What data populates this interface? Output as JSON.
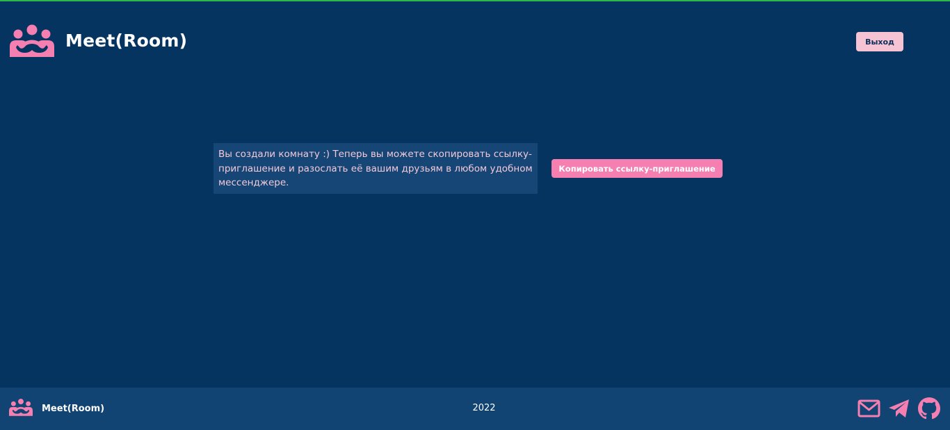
{
  "header": {
    "logo_icon": "people-group-icon",
    "logo_text": "Meet(Room)",
    "exit_label": "Выход"
  },
  "main": {
    "message": "Вы создали комнату :) Теперь вы можете скопировать ссылку-приглашение и разослать её вашим друзьям в любом удобном мессенджере.",
    "copy_button_label": "Копировать ссылку-приглашение"
  },
  "footer": {
    "logo_icon": "people-group-icon",
    "logo_text": "Meet(Room)",
    "year": "2022",
    "icons": [
      "mail-icon",
      "telegram-icon",
      "github-icon"
    ]
  },
  "colors": {
    "background": "#063460",
    "footer_background": "#114473",
    "accent_pink": "#f47fb0",
    "light_pink": "#f6c3d4",
    "message_box": "#154676"
  }
}
